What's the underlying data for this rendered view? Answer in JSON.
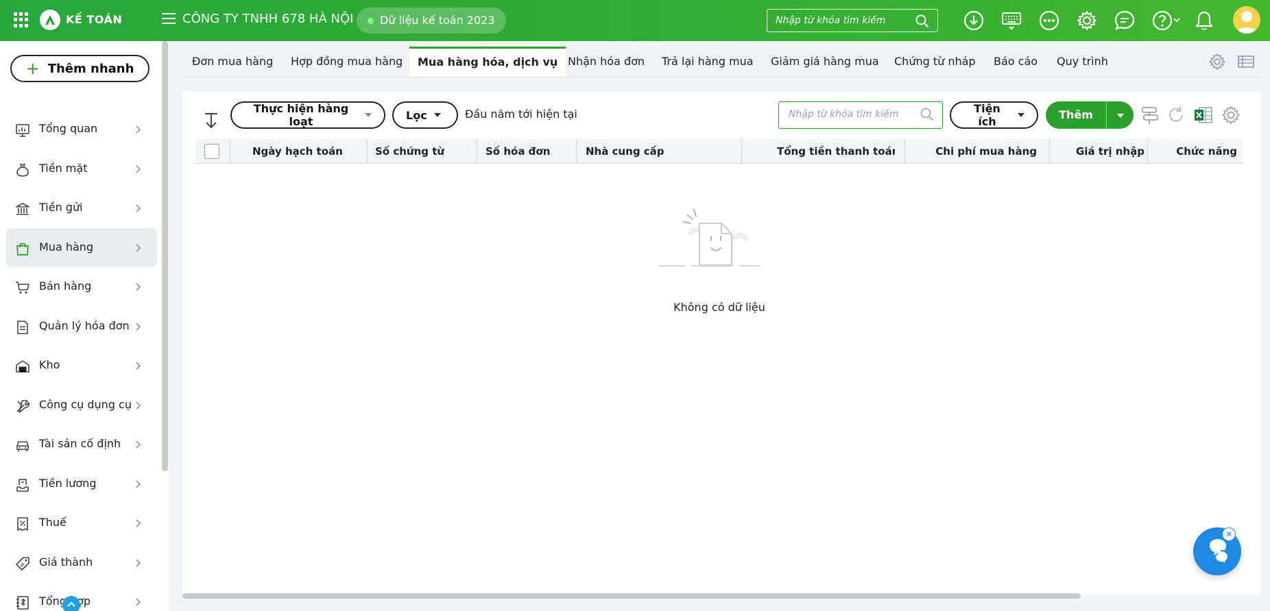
{
  "header": {
    "app_name": "KẾ TOÁN",
    "company": "CÔNG TY TNHH 678 HÀ NỘI",
    "dataset_pill": "Dữ liệu kế toán 2023",
    "search_placeholder": "Nhập từ khóa tìm kiếm",
    "icons": [
      "download-icon",
      "keyboard-icon",
      "more-icon",
      "gear-icon",
      "chat-icon",
      "help-icon",
      "bell-icon"
    ]
  },
  "sidebar": {
    "quick_add": "Thêm nhanh",
    "items": [
      {
        "label": "Tổng quan",
        "icon": "dashboard-icon",
        "active": false
      },
      {
        "label": "Tiền mặt",
        "icon": "cash-bag-icon",
        "active": false
      },
      {
        "label": "Tiền gửi",
        "icon": "bank-icon",
        "active": false
      },
      {
        "label": "Mua hàng",
        "icon": "shopping-bag-icon",
        "active": true
      },
      {
        "label": "Bán hàng",
        "icon": "cart-icon",
        "active": false
      },
      {
        "label": "Quản lý hóa đơn",
        "icon": "invoice-icon",
        "active": false
      },
      {
        "label": "Kho",
        "icon": "warehouse-icon",
        "active": false
      },
      {
        "label": "Công cụ dụng cụ",
        "icon": "tools-icon",
        "active": false
      },
      {
        "label": "Tài sản cố định",
        "icon": "car-icon",
        "active": false
      },
      {
        "label": "Tiền lương",
        "icon": "payroll-icon",
        "active": false
      },
      {
        "label": "Thuế",
        "icon": "tax-icon",
        "active": false
      },
      {
        "label": "Giá thành",
        "icon": "price-tag-icon",
        "active": false
      },
      {
        "label": "Tổng hợp",
        "icon": "summary-icon",
        "active": false
      }
    ]
  },
  "tabs": [
    {
      "label": "Đơn mua hàng",
      "active": false
    },
    {
      "label": "Hợp đồng mua hàng",
      "active": false
    },
    {
      "label": "Mua hàng hóa, dịch vụ",
      "active": true
    },
    {
      "label": "Nhận hóa đơn",
      "active": false
    },
    {
      "label": "Trả lại hàng mua",
      "active": false
    },
    {
      "label": "Giảm giá hàng mua",
      "active": false
    },
    {
      "label": "Chứng từ nháp",
      "active": false
    },
    {
      "label": "Báo cáo",
      "active": false
    },
    {
      "label": "Quy trình",
      "active": false
    }
  ],
  "toolbar": {
    "batch_action": "Thực hiện hàng loạt",
    "filter": "Lọc",
    "period": "Đầu năm tới hiện tại",
    "search_placeholder": "Nhập từ khóa tìm kiếm",
    "utilities": "Tiện ích",
    "add": "Thêm"
  },
  "table": {
    "columns": [
      "Ngày hạch toán",
      "Số chứng từ",
      "Số hóa đơn",
      "Nhà cung cấp",
      "Tổng tiền thanh toán",
      "Chi phí mua hàng",
      "Giá trị nhập kh",
      "Chức năng"
    ],
    "rows": [],
    "empty_text": "Không có dữ liệu"
  },
  "colors": {
    "brand_green": "#2ba02a",
    "header_green": "#33ad32",
    "chat_blue": "#1e88e5"
  }
}
